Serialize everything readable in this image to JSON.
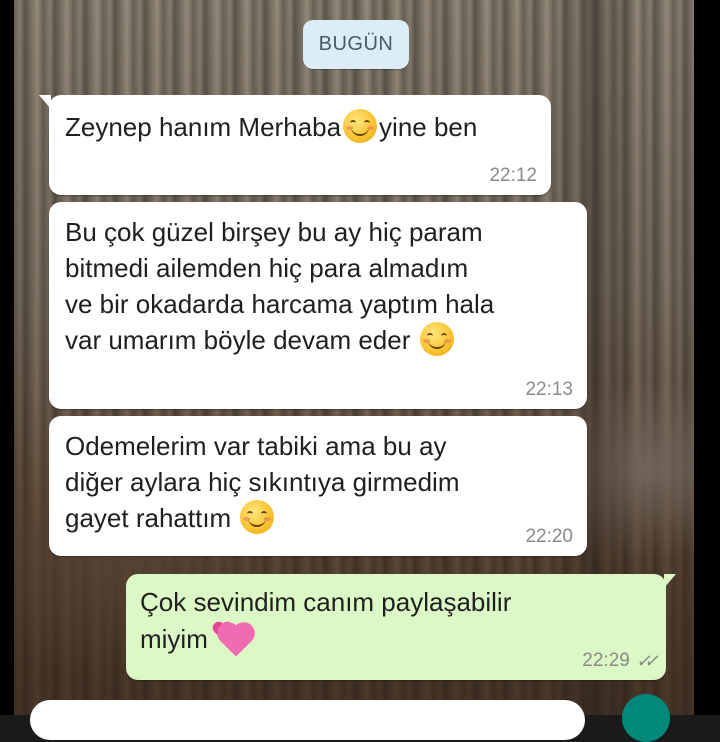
{
  "chat": {
    "date_label": "BUGÜN",
    "messages": [
      {
        "text_before": "Zeynep hanım Merhaba",
        "text_after": "yine ben",
        "emoji": "smiling-face-icon",
        "time": "22:12",
        "direction": "incoming"
      },
      {
        "text": "Bu çok güzel birşey bu ay hiç param\nbitmedi ailemden hiç para almadım\nve bir okadarda harcama yaptım hala\nvar umarım böyle devam eder ",
        "emoji": "smiling-face-icon",
        "time": "22:13",
        "direction": "incoming"
      },
      {
        "text": "Odemelerim var tabiki ama bu ay\ndiğer aylara hiç sıkıntıya girmedim\ngayet rahattım ",
        "emoji": "smiling-face-icon",
        "time": "22:20",
        "direction": "incoming"
      },
      {
        "text": "Çok sevindim canım paylaşabilir\nmiyim ",
        "emoji": "two-hearts-icon",
        "time": "22:29",
        "status": "read-double-check-icon",
        "direction": "outgoing"
      }
    ]
  },
  "colors": {
    "incoming_bubble": "#ffffff",
    "outgoing_bubble": "#dcf8c6",
    "date_pill": "#dcedf7",
    "send_button": "#00897b"
  }
}
